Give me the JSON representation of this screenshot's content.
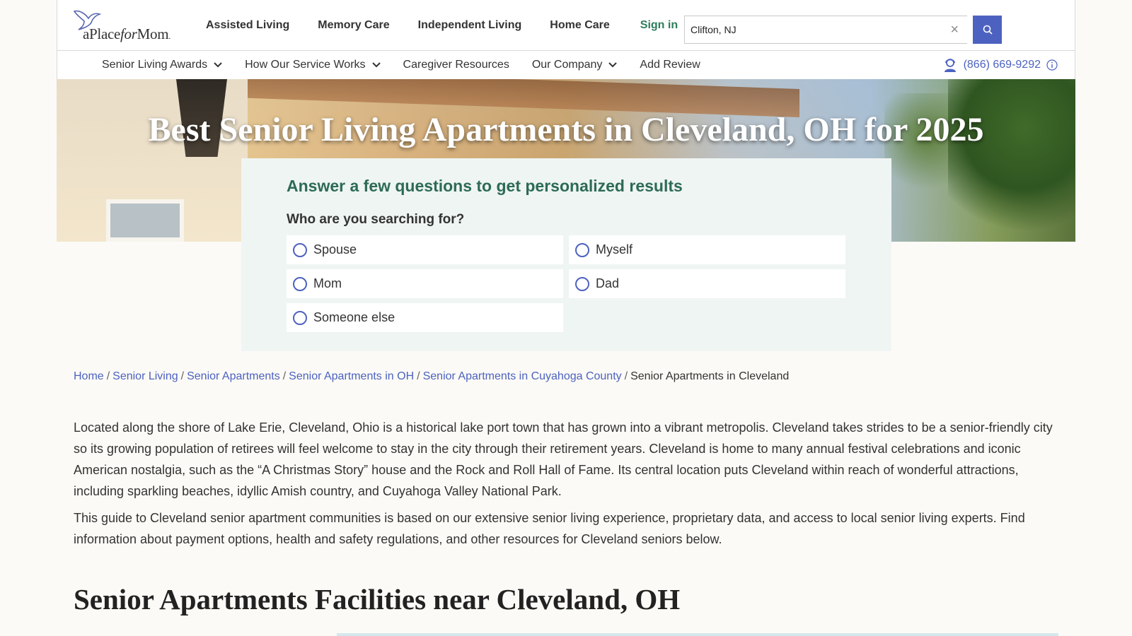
{
  "header": {
    "logo_text_1": "a",
    "logo_text_2": "Place",
    "logo_text_3": "for",
    "logo_text_4": "Mom",
    "logo_text_5": ".",
    "nav": [
      {
        "label": "Assisted Living"
      },
      {
        "label": "Memory Care"
      },
      {
        "label": "Independent Living"
      },
      {
        "label": "Home Care"
      }
    ],
    "signin_label": "Sign in",
    "search_value": "Clifton, NJ",
    "clear_glyph": "×"
  },
  "subnav": {
    "items": [
      {
        "label": "Senior Living Awards",
        "has_dropdown": true
      },
      {
        "label": "How Our Service Works",
        "has_dropdown": true
      },
      {
        "label": "Caregiver Resources",
        "has_dropdown": false
      },
      {
        "label": "Our Company",
        "has_dropdown": true
      },
      {
        "label": "Add Review",
        "has_dropdown": false
      }
    ],
    "phone": "(866) 669-9292"
  },
  "hero": {
    "title": "Best Senior Living Apartments in Cleveland, OH for 2025"
  },
  "quiz": {
    "heading": "Answer a few questions to get personalized results",
    "question": "Who are you searching for?",
    "options": [
      {
        "label": "Spouse"
      },
      {
        "label": "Myself"
      },
      {
        "label": "Mom"
      },
      {
        "label": "Dad"
      },
      {
        "label": "Someone else"
      }
    ]
  },
  "breadcrumb": {
    "links": [
      {
        "label": "Home"
      },
      {
        "label": "Senior Living"
      },
      {
        "label": "Senior Apartments"
      },
      {
        "label": "Senior Apartments in OH"
      },
      {
        "label": "Senior Apartments in Cuyahoga County"
      }
    ],
    "separator": "/",
    "current": "Senior Apartments in Cleveland"
  },
  "content": {
    "paragraph_1": "Located along the shore of Lake Erie, Cleveland, Ohio is a historical lake port town that has grown into a vibrant metropolis. Cleveland takes strides to be a senior-friendly city so its growing population of retirees will feel welcome to stay in the city through their retirement years. Cleveland is home to many annual festival celebrations and iconic American nostalgia, such as the “A Christmas Story” house and the Rock and Roll Hall of Fame. Its central location puts Cleveland within reach of wonderful attractions, including sparkling beaches, idyllic Amish country, and Cuyahoga Valley National Park.",
    "paragraph_2": "This guide to Cleveland senior apartment communities is based on our extensive senior living experience, proprietary data, and access to local senior living experts. Find information about payment options, health and safety regulations, and other resources for Cleveland seniors below.",
    "section_title": "Senior Apartments Facilities near Cleveland, OH"
  },
  "colors": {
    "brand_blue": "#4d62c0",
    "brand_green": "#2e7d5b",
    "heading_green": "#2d6b54"
  },
  "icons": [
    "bird-logo-icon",
    "search-icon",
    "close-icon",
    "chevron-down-icon",
    "agent-icon",
    "info-icon",
    "radio-icon"
  ]
}
